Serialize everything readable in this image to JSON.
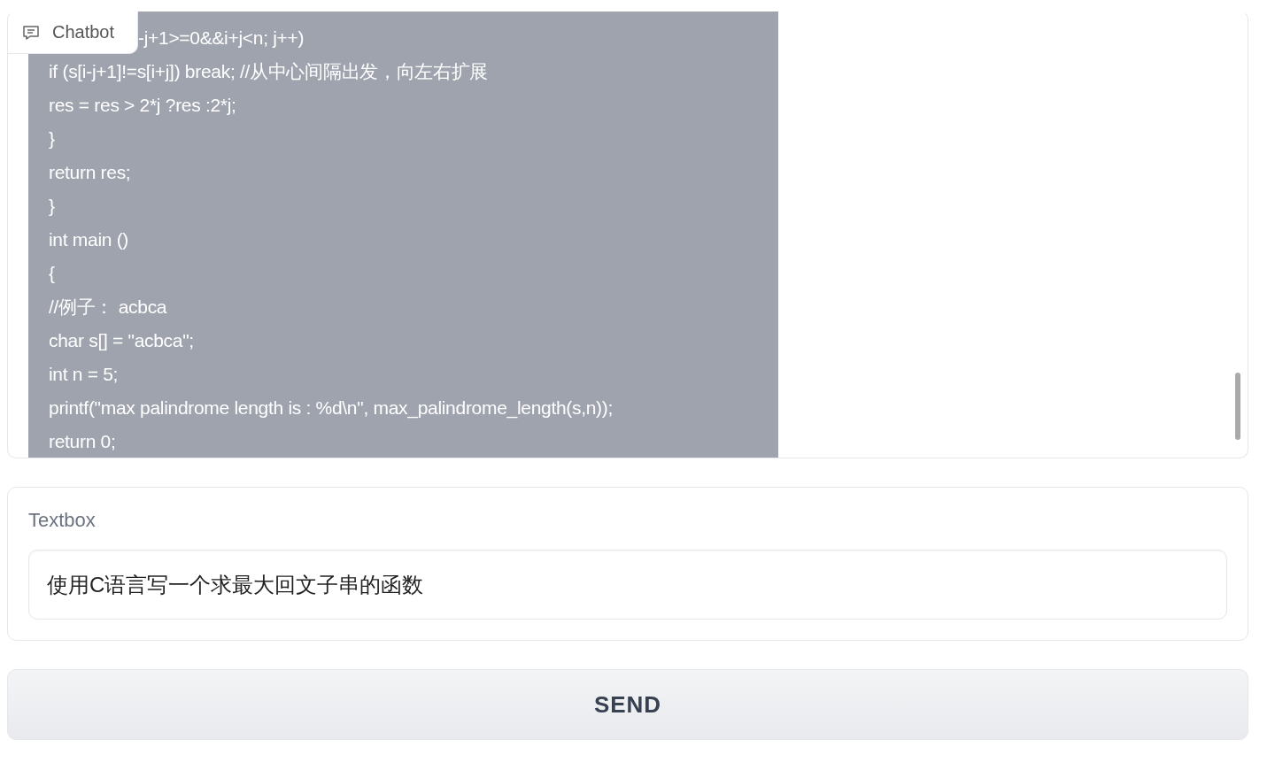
{
  "chatbot": {
    "label": "Chatbot",
    "message_lines": [
      "-j+1>=0&&i+j<n; j++)",
      "if (s[i-j+1]!=s[i+j]) break; //从中心间隔出发，向左右扩展",
      "res = res > 2*j ?res :2*j;",
      "}",
      "return res;",
      "}",
      "int main ()",
      "{",
      "//例子： acbca",
      "char s[] = \"acbca\";",
      "int n = 5;",
      "printf(\"max palindrome length is : %d\\n\", max_palindrome_length(s,n));",
      "return 0;"
    ]
  },
  "textbox": {
    "label": "Textbox",
    "value": "使用C语言写一个求最大回文子串的函数"
  },
  "send_button": "SEND"
}
